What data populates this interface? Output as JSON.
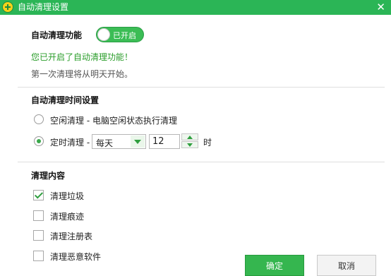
{
  "window": {
    "title": "自动清理设置",
    "close_glyph": "✕"
  },
  "auto_clean": {
    "heading": "自动清理功能",
    "toggle_label": "已开启",
    "toggle_on": true,
    "status_message": "您已开启了自动清理功能！",
    "start_note": "第一次清理将从明天开始。"
  },
  "schedule": {
    "heading": "自动清理时间设置",
    "idle_option": "空闲清理 - 电脑空闲状态执行清理",
    "timed_option": "定时清理 -",
    "selected_option": "timed",
    "frequency": "每天",
    "hour": "12",
    "hour_unit": "时"
  },
  "content": {
    "heading": "清理内容",
    "items": [
      {
        "label": "清理垃圾",
        "checked": true
      },
      {
        "label": "清理痕迹",
        "checked": false
      },
      {
        "label": "清理注册表",
        "checked": false
      },
      {
        "label": "清理恶意软件",
        "checked": false
      }
    ]
  },
  "buttons": {
    "ok": "确定",
    "cancel": "取消"
  },
  "colors": {
    "accent": "#2bb556",
    "ok_button": "#35b64f",
    "status_green": "#2a9d2a"
  }
}
